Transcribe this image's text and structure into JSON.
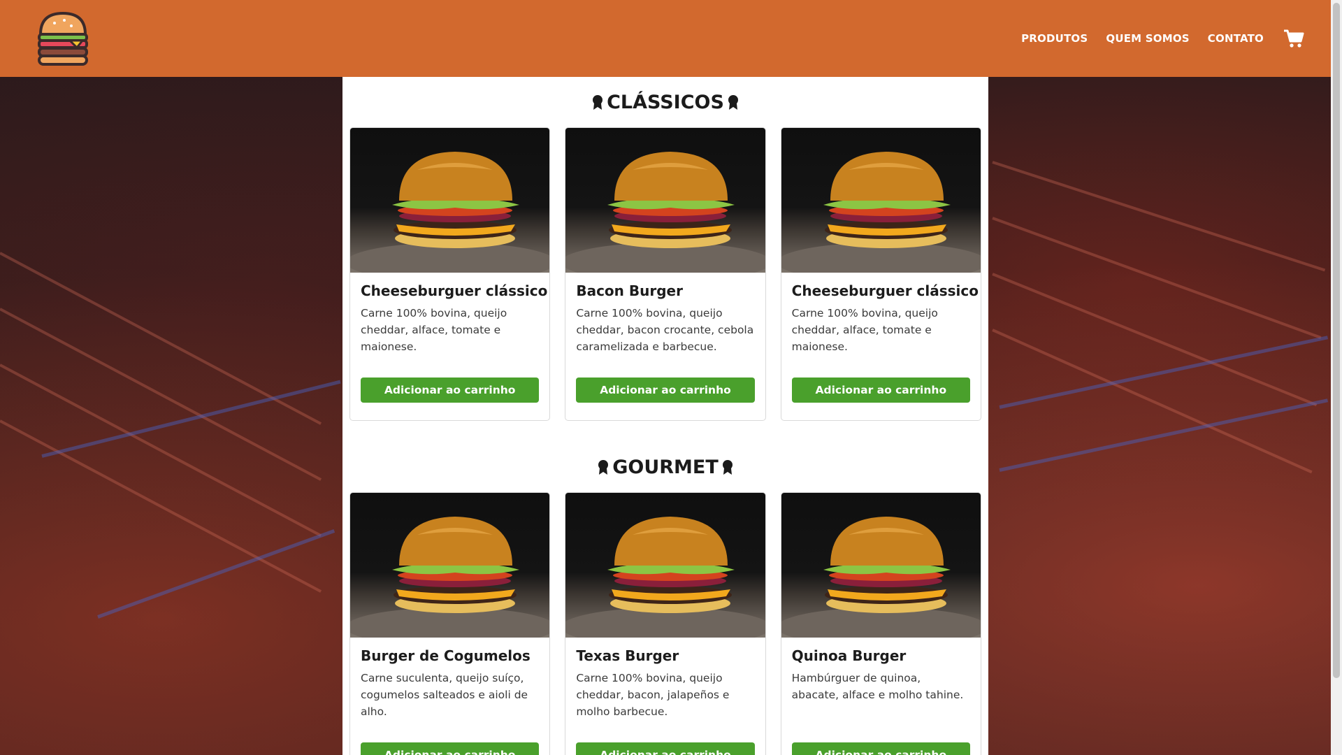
{
  "header": {
    "nav": [
      "PRODUTOS",
      "QUEM SOMOS",
      "CONTATO"
    ]
  },
  "sections": [
    {
      "title": "CLÁSSICOS",
      "items": [
        {
          "name": "Cheeseburguer clássico",
          "description": "Carne 100% bovina, queijo cheddar, alface, tomate e maionese.",
          "button": "Adicionar ao carrinho"
        },
        {
          "name": "Bacon Burger",
          "description": "Carne 100% bovina, queijo cheddar, bacon crocante, cebola caramelizada e barbecue.",
          "button": "Adicionar ao carrinho"
        },
        {
          "name": "Cheeseburguer clássico",
          "description": "Carne 100% bovina, queijo cheddar, alface, tomate e maionese.",
          "button": "Adicionar ao carrinho"
        }
      ]
    },
    {
      "title": "GOURMET",
      "items": [
        {
          "name": "Burger de Cogumelos",
          "description": "Carne suculenta, queijo suíço, cogumelos salteados e aioli de alho.",
          "button": "Adicionar ao carrinho"
        },
        {
          "name": "Texas Burger",
          "description": "Carne 100% bovina, queijo cheddar, bacon, jalapeños e molho barbecue.",
          "button": "Adicionar ao carrinho"
        },
        {
          "name": "Quinoa Burger",
          "description": "Hambúrguer de quinoa, abacate, alface e molho tahine.",
          "button": "Adicionar ao carrinho"
        }
      ]
    }
  ],
  "colors": {
    "header": "#d2692e",
    "button": "#4aa02c",
    "text": "#1b1b1b"
  },
  "icons": [
    "burger-logo-icon",
    "shopping-cart-icon",
    "medal-icon"
  ]
}
